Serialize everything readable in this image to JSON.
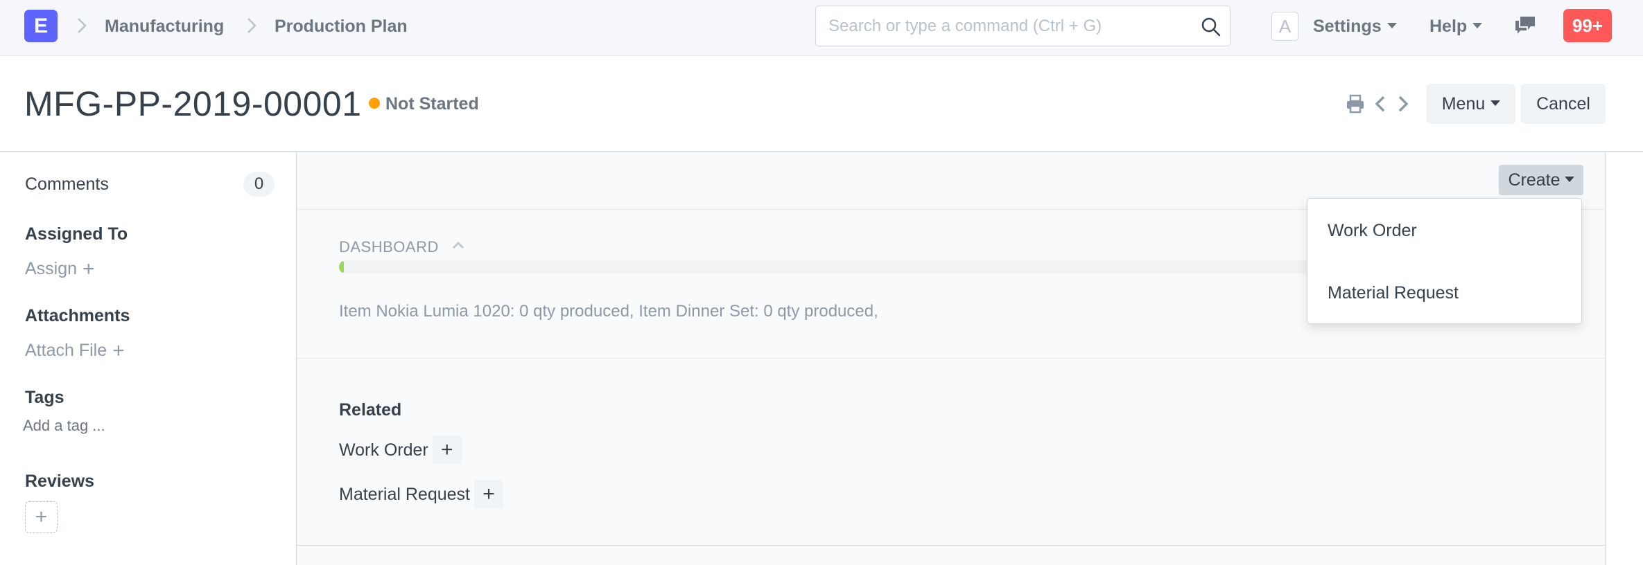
{
  "navbar": {
    "logo_letter": "E",
    "breadcrumbs": [
      "Manufacturing",
      "Production Plan"
    ],
    "search_placeholder": "Search or type a command (Ctrl + G)",
    "avatar_letter": "A",
    "settings_label": "Settings",
    "help_label": "Help",
    "notifications_count": "99+"
  },
  "page_head": {
    "title": "MFG-PP-2019-00001",
    "status": "Not Started",
    "status_color": "#ffa00a",
    "menu_label": "Menu",
    "cancel_label": "Cancel"
  },
  "sidebar": {
    "comments_label": "Comments",
    "comments_count": "0",
    "assigned_to_heading": "Assigned To",
    "assign_label": "Assign",
    "attachments_heading": "Attachments",
    "attach_file_label": "Attach File",
    "tags_heading": "Tags",
    "add_tag_label": "Add a tag ...",
    "reviews_heading": "Reviews"
  },
  "toolbar": {
    "create_label": "Create"
  },
  "create_dropdown": {
    "items": [
      "Work Order",
      "Material Request"
    ]
  },
  "dashboard": {
    "label": "DASHBOARD",
    "progress_fraction": 0.004,
    "progress_color": "#98d85b",
    "message": "Item Nokia Lumia 1020: 0 qty produced, Item Dinner Set: 0 qty produced,"
  },
  "related": {
    "title": "Related",
    "items": [
      "Work Order",
      "Material Request"
    ]
  }
}
